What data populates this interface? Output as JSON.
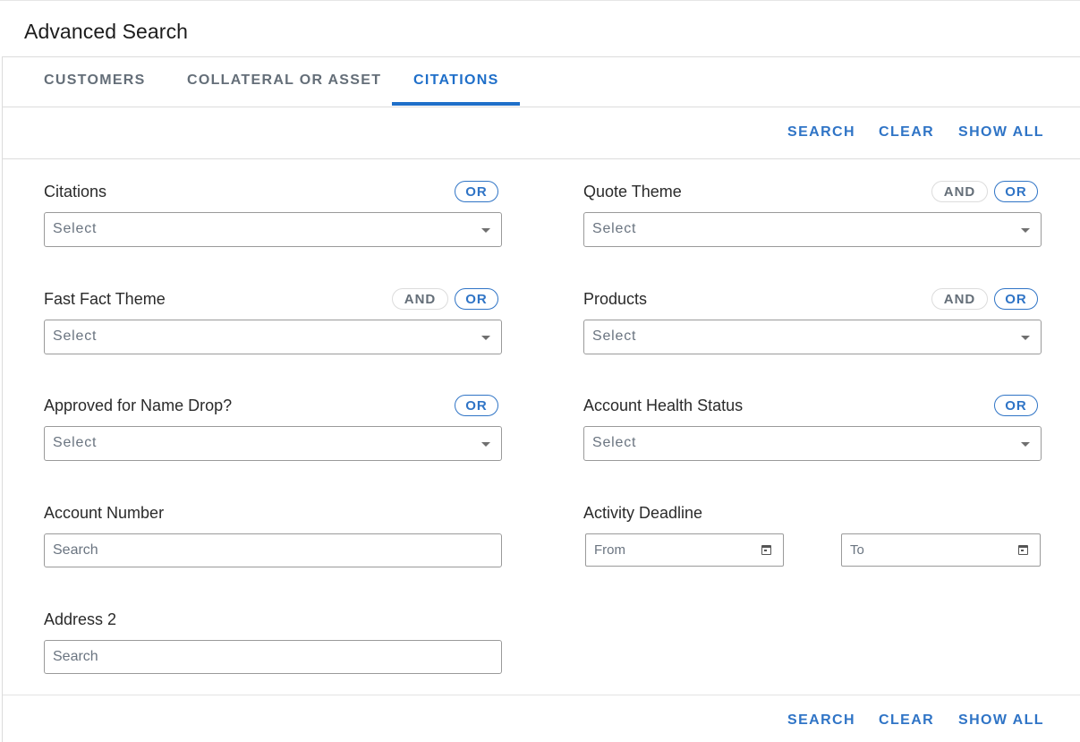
{
  "page": {
    "title": "Advanced Search"
  },
  "tabs": [
    {
      "label": "CUSTOMERS",
      "active": false
    },
    {
      "label": "COLLATERAL OR ASSET",
      "active": false
    },
    {
      "label": "CITATIONS",
      "active": true
    }
  ],
  "actions": {
    "search": "SEARCH",
    "clear": "CLEAR",
    "show_all": "SHOW ALL"
  },
  "operators": {
    "and": "AND",
    "or": "OR"
  },
  "fields": {
    "citations": {
      "label": "Citations",
      "placeholder": "Select"
    },
    "quote_theme": {
      "label": "Quote Theme",
      "placeholder": "Select"
    },
    "fast_fact_theme": {
      "label": "Fast Fact Theme",
      "placeholder": "Select"
    },
    "products": {
      "label": "Products",
      "placeholder": "Select"
    },
    "approved_name_drop": {
      "label": "Approved for Name Drop?",
      "placeholder": "Select"
    },
    "account_health_status": {
      "label": "Account Health Status",
      "placeholder": "Select"
    },
    "account_number": {
      "label": "Account Number",
      "placeholder": "Search"
    },
    "activity_deadline": {
      "label": "Activity Deadline",
      "from_placeholder": "From",
      "to_placeholder": "To"
    },
    "address_2": {
      "label": "Address 2",
      "placeholder": "Search"
    }
  },
  "colors": {
    "accent": "#1f6fc9",
    "link": "#2f74c6",
    "muted": "#646e78",
    "border": "#9a9a9a"
  },
  "icons": {
    "dropdown": "caret-down-icon",
    "date": "calendar-icon"
  }
}
